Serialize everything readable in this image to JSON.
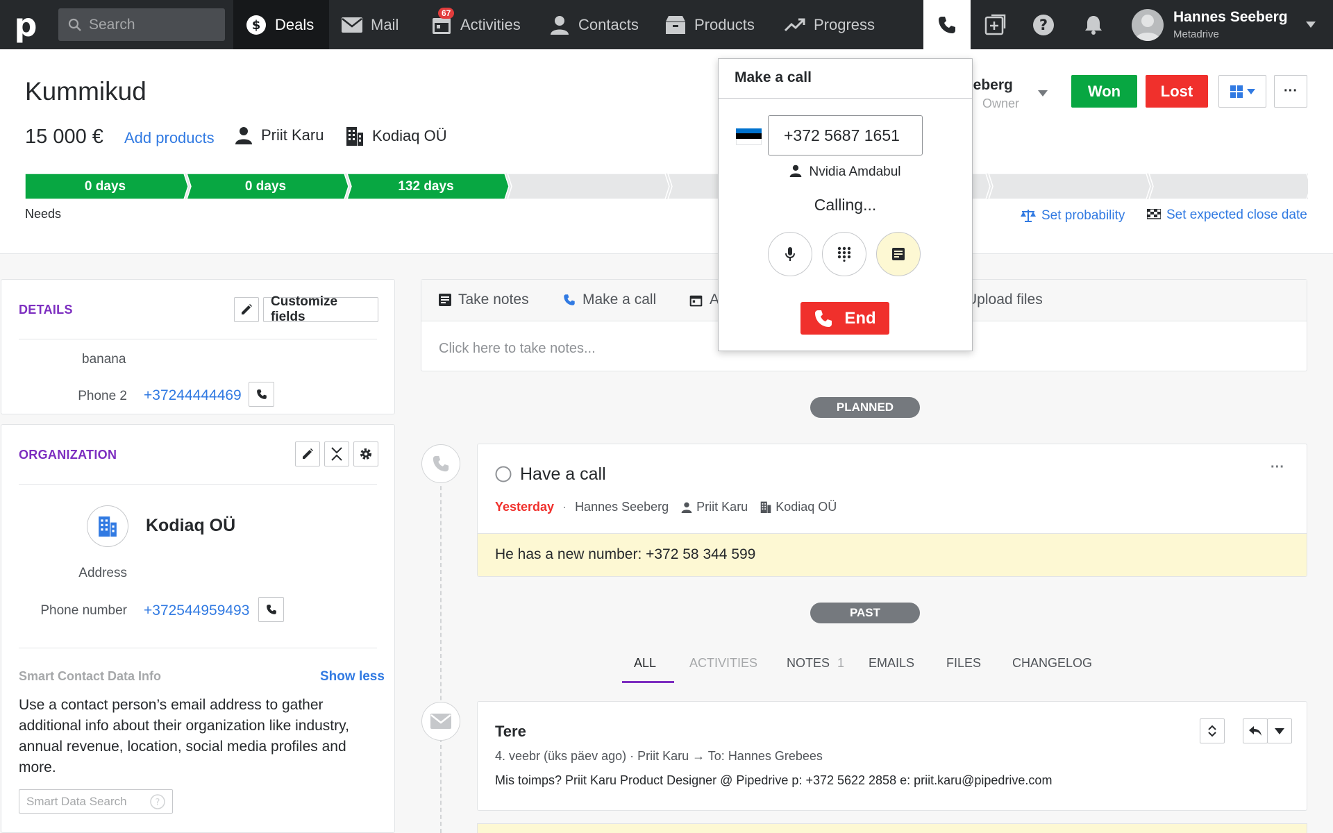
{
  "topbar": {
    "logo": "p",
    "search_placeholder": "Search",
    "nav": [
      {
        "label": "Deals",
        "icon": "dollar-icon"
      },
      {
        "label": "Mail",
        "icon": "mail-icon"
      },
      {
        "label": "Activities",
        "icon": "calendar-icon",
        "badge": "67"
      },
      {
        "label": "Contacts",
        "icon": "person-icon"
      },
      {
        "label": "Products",
        "icon": "box-icon"
      },
      {
        "label": "Progress",
        "icon": "trend-icon"
      }
    ],
    "user": {
      "name": "Hannes Seeberg",
      "org": "Metadrive"
    }
  },
  "deal": {
    "title": "Kummikud",
    "value": "15 000 €",
    "add_products": "Add products",
    "person": "Priit Karu",
    "organization": "Kodiaq OÜ",
    "stages": [
      {
        "label": "0 days",
        "status": "done"
      },
      {
        "label": "0 days",
        "status": "done"
      },
      {
        "label": "132 days",
        "status": "done"
      },
      {
        "label": "",
        "status": "todo"
      },
      {
        "label": "",
        "status": "todo"
      },
      {
        "label": "",
        "status": "todo"
      },
      {
        "label": "",
        "status": "todo"
      },
      {
        "label": "",
        "status": "todo"
      }
    ],
    "current_stage_label": "Needs",
    "owner_name": "eeberg",
    "owner_role": "Owner",
    "won_label": "Won",
    "lost_label": "Lost",
    "more_label": "···",
    "set_probability": "Set probability",
    "set_close_date": "Set expected close date"
  },
  "details": {
    "title": "DETAILS",
    "customize": "Customize fields",
    "value_banana": "banana",
    "phone2_label": "Phone 2",
    "phone2_value": "+37244444469"
  },
  "organization": {
    "title": "ORGANIZATION",
    "name": "Kodiaq OÜ",
    "address_label": "Address",
    "phone_label": "Phone number",
    "phone_value": "+372544959493",
    "smart_title": "Smart Contact Data Info",
    "show_less": "Show less",
    "smart_text": "Use a contact person’s email address to gather additional info about their organization like industry, annual revenue, location, social media profiles and more.",
    "smart_search": "Smart Data Search"
  },
  "composer": {
    "tabs": [
      "Take notes",
      "Make a call",
      "A",
      "Upload files"
    ],
    "placeholder": "Click here to take notes..."
  },
  "timeline": {
    "planned_label": "PLANNED",
    "past_label": "PAST",
    "activity": {
      "title": "Have a call",
      "due": "Yesterday",
      "owner": "Hannes Seeberg",
      "person": "Priit Karu",
      "org": "Kodiaq OÜ",
      "note": "He has a new number: +372 58 344 599",
      "more": "···"
    },
    "history_tabs": [
      {
        "label": "ALL",
        "count": ""
      },
      {
        "label": "ACTIVITIES",
        "count": ""
      },
      {
        "label": "NOTES",
        "count": "1"
      },
      {
        "label": "EMAILS",
        "count": ""
      },
      {
        "label": "FILES",
        "count": ""
      },
      {
        "label": "CHANGELOG",
        "count": ""
      }
    ],
    "email": {
      "subject": "Tere",
      "meta": "4. veebr (üks päev ago) · Priit Karu → To: Hannes Grebees",
      "body": "Mis toimps? Priit Karu Product Designer @ Pipedrive p: +372 5622 2858 e: priit.karu@pipedrive.com"
    }
  },
  "call": {
    "title": "Make a call",
    "number": "+372 5687 1651",
    "callee": "Nvidia Amdabul",
    "status": "Calling...",
    "end_label": "End"
  },
  "colors": {
    "accent_purple": "#7d2ec0",
    "link_blue": "#317ae2",
    "won_green": "#08a742",
    "lost_red": "#f0302c",
    "stage_green": "#08a742",
    "flag": [
      "#0072ce",
      "#000000",
      "#ffffff"
    ]
  }
}
